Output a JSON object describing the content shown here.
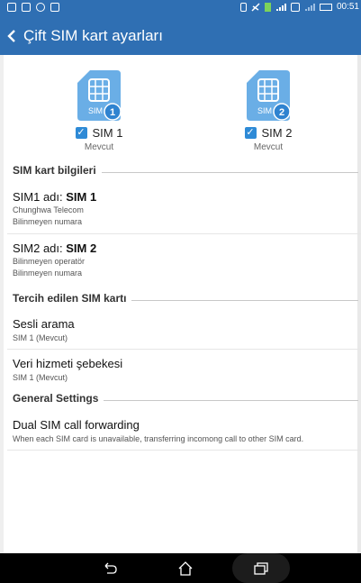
{
  "status_bar": {
    "time": "00:51"
  },
  "header": {
    "title": "Çift SIM kart ayarları"
  },
  "sims": [
    {
      "label": "SIM 1",
      "status": "Mevcut",
      "card_text": "SIM",
      "badge": "1",
      "checked": true
    },
    {
      "label": "SIM 2",
      "status": "Mevcut",
      "card_text": "SIM",
      "badge": "2",
      "checked": true
    }
  ],
  "sections": {
    "sim_info": "SIM kart bilgileri",
    "preferred": "Tercih edilen SIM kartı",
    "general": "General Settings"
  },
  "sim_info_items": [
    {
      "prefix": "SIM1 adı: ",
      "name": "SIM 1",
      "line1": "Chunghwa Telecom",
      "line2": "Bilinmeyen numara"
    },
    {
      "prefix": "SIM2 adı: ",
      "name": "SIM 2",
      "line1": "Bilinmeyen operatör",
      "line2": "Bilinmeyen numara"
    }
  ],
  "preferred_items": [
    {
      "title": "Sesli arama",
      "sub": "SIM 1 (Mevcut)"
    },
    {
      "title": "Veri hizmeti şebekesi",
      "sub": "SIM 1 (Mevcut)"
    }
  ],
  "general_items": [
    {
      "title": "Dual SIM call forwarding",
      "sub": "When each SIM card is unavailable, transferring incomong call to other SIM card."
    }
  ],
  "colors": {
    "header": "#2f6fb3",
    "sim_card": "#6aaee6",
    "badge": "#2f83d0",
    "checkbox": "#2e8ad6"
  },
  "icons": [
    "back-arrow-icon",
    "sim-card-icon",
    "checkbox-icon",
    "back-nav-icon",
    "home-nav-icon",
    "recents-nav-icon"
  ]
}
